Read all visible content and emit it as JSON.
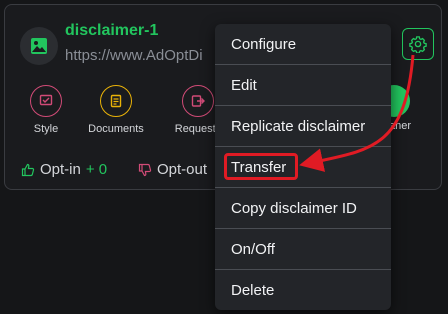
{
  "card": {
    "title": "disclaimer-1",
    "url": "https://www.AdOptDi",
    "actions": [
      {
        "label": "Style",
        "color": "#d14b77"
      },
      {
        "label": "Documents",
        "color": "#eab308"
      },
      {
        "label": "Requests",
        "color": "#d14b77"
      }
    ],
    "clipped_label": "aner",
    "opt_in": {
      "label": "Opt-in",
      "count": "+ 0"
    },
    "opt_out": {
      "label": "Opt-out"
    }
  },
  "menu": {
    "items": [
      "Configure",
      "Edit",
      "Replicate disclaimer",
      "Transfer",
      "Copy disclaimer ID",
      "On/Off",
      "Delete"
    ]
  },
  "colors": {
    "accent": "#22c55e",
    "danger": "#d14b77",
    "highlight": "#e01b24"
  }
}
